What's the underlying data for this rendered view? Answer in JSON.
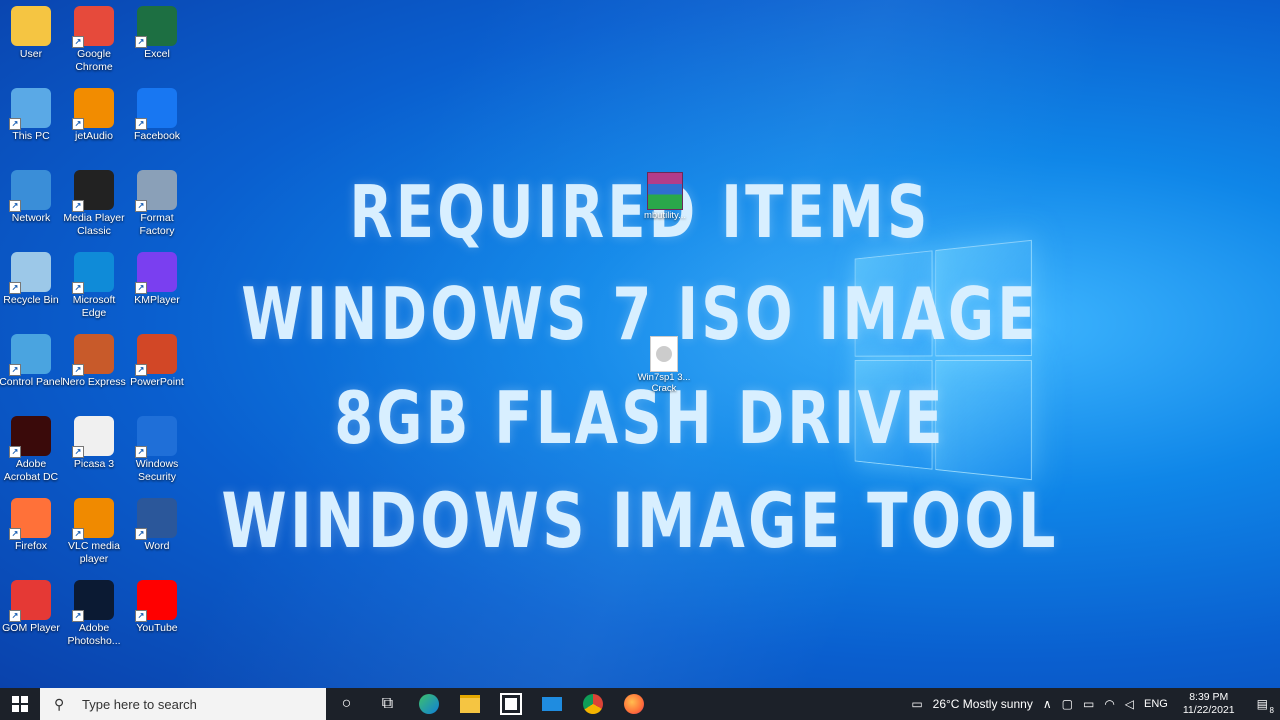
{
  "desktop_icons": [
    {
      "label": "User",
      "icon": "user-folder-icon",
      "color": "#f5c542"
    },
    {
      "label": "Google Chrome",
      "icon": "chrome-icon",
      "color": "#e64a3b"
    },
    {
      "label": "Excel",
      "icon": "excel-icon",
      "color": "#1d6f42"
    },
    {
      "label": "This PC",
      "icon": "computer-icon",
      "color": "#5aa9e6"
    },
    {
      "label": "jetAudio",
      "icon": "jetaudio-icon",
      "color": "#f28c00"
    },
    {
      "label": "Facebook",
      "icon": "facebook-icon",
      "color": "#1877f2"
    },
    {
      "label": "Network",
      "icon": "network-icon",
      "color": "#3a8ed8"
    },
    {
      "label": "Media Player Classic",
      "icon": "media-player-icon",
      "color": "#222222"
    },
    {
      "label": "Format Factory",
      "icon": "format-factory-icon",
      "color": "#8aa0b8"
    },
    {
      "label": "Recycle Bin",
      "icon": "recycle-bin-icon",
      "color": "#9cc8e8"
    },
    {
      "label": "Microsoft Edge",
      "icon": "edge-icon",
      "color": "#0f8bd8"
    },
    {
      "label": "KMPlayer",
      "icon": "kmplayer-icon",
      "color": "#7a3ff0"
    },
    {
      "label": "Control Panel",
      "icon": "control-panel-icon",
      "color": "#4aa4e0"
    },
    {
      "label": "Nero Express",
      "icon": "nero-icon",
      "color": "#c85a2a"
    },
    {
      "label": "PowerPoint",
      "icon": "powerpoint-icon",
      "color": "#d24726"
    },
    {
      "label": "Adobe Acrobat DC",
      "icon": "acrobat-icon",
      "color": "#3a0a0a"
    },
    {
      "label": "Picasa 3",
      "icon": "picasa-icon",
      "color": "#f0f0f0"
    },
    {
      "label": "Windows Security",
      "icon": "shield-icon",
      "color": "#1f6fd8"
    },
    {
      "label": "Firefox",
      "icon": "firefox-icon",
      "color": "#ff7139"
    },
    {
      "label": "VLC media player",
      "icon": "vlc-icon",
      "color": "#f08a00"
    },
    {
      "label": "Word",
      "icon": "word-icon",
      "color": "#2b579a"
    },
    {
      "label": "GOM Player",
      "icon": "gom-player-icon",
      "color": "#e53935"
    },
    {
      "label": "Adobe Photosho...",
      "icon": "photoshop-icon",
      "color": "#0b1a33"
    },
    {
      "label": "YouTube",
      "icon": "youtube-icon",
      "color": "#ff0000"
    }
  ],
  "overlay_text": {
    "line1": "REQUIRED ITEMS",
    "line2": "WINDOWS 7 ISO IMAGE",
    "line3": "8GB  FLASH DRIVE",
    "line4": "WINDOWS IMAGE TOOL"
  },
  "desktop_files": [
    {
      "label": "mbutility...",
      "icon": "winrar-archive-icon"
    },
    {
      "label": "Win7sp1 3... Crack",
      "icon": "disc-image-icon"
    }
  ],
  "taskbar": {
    "search_placeholder": "Type here to search",
    "apps": [
      "cortana-icon",
      "task-view-icon",
      "edge-icon",
      "file-explorer-icon",
      "store-icon",
      "mail-icon",
      "chrome-icon",
      "firefox-icon"
    ],
    "weather": "26°C  Mostly sunny",
    "language": "ENG",
    "time": "8:39 PM",
    "date": "11/22/2021",
    "notification_count": "8"
  }
}
